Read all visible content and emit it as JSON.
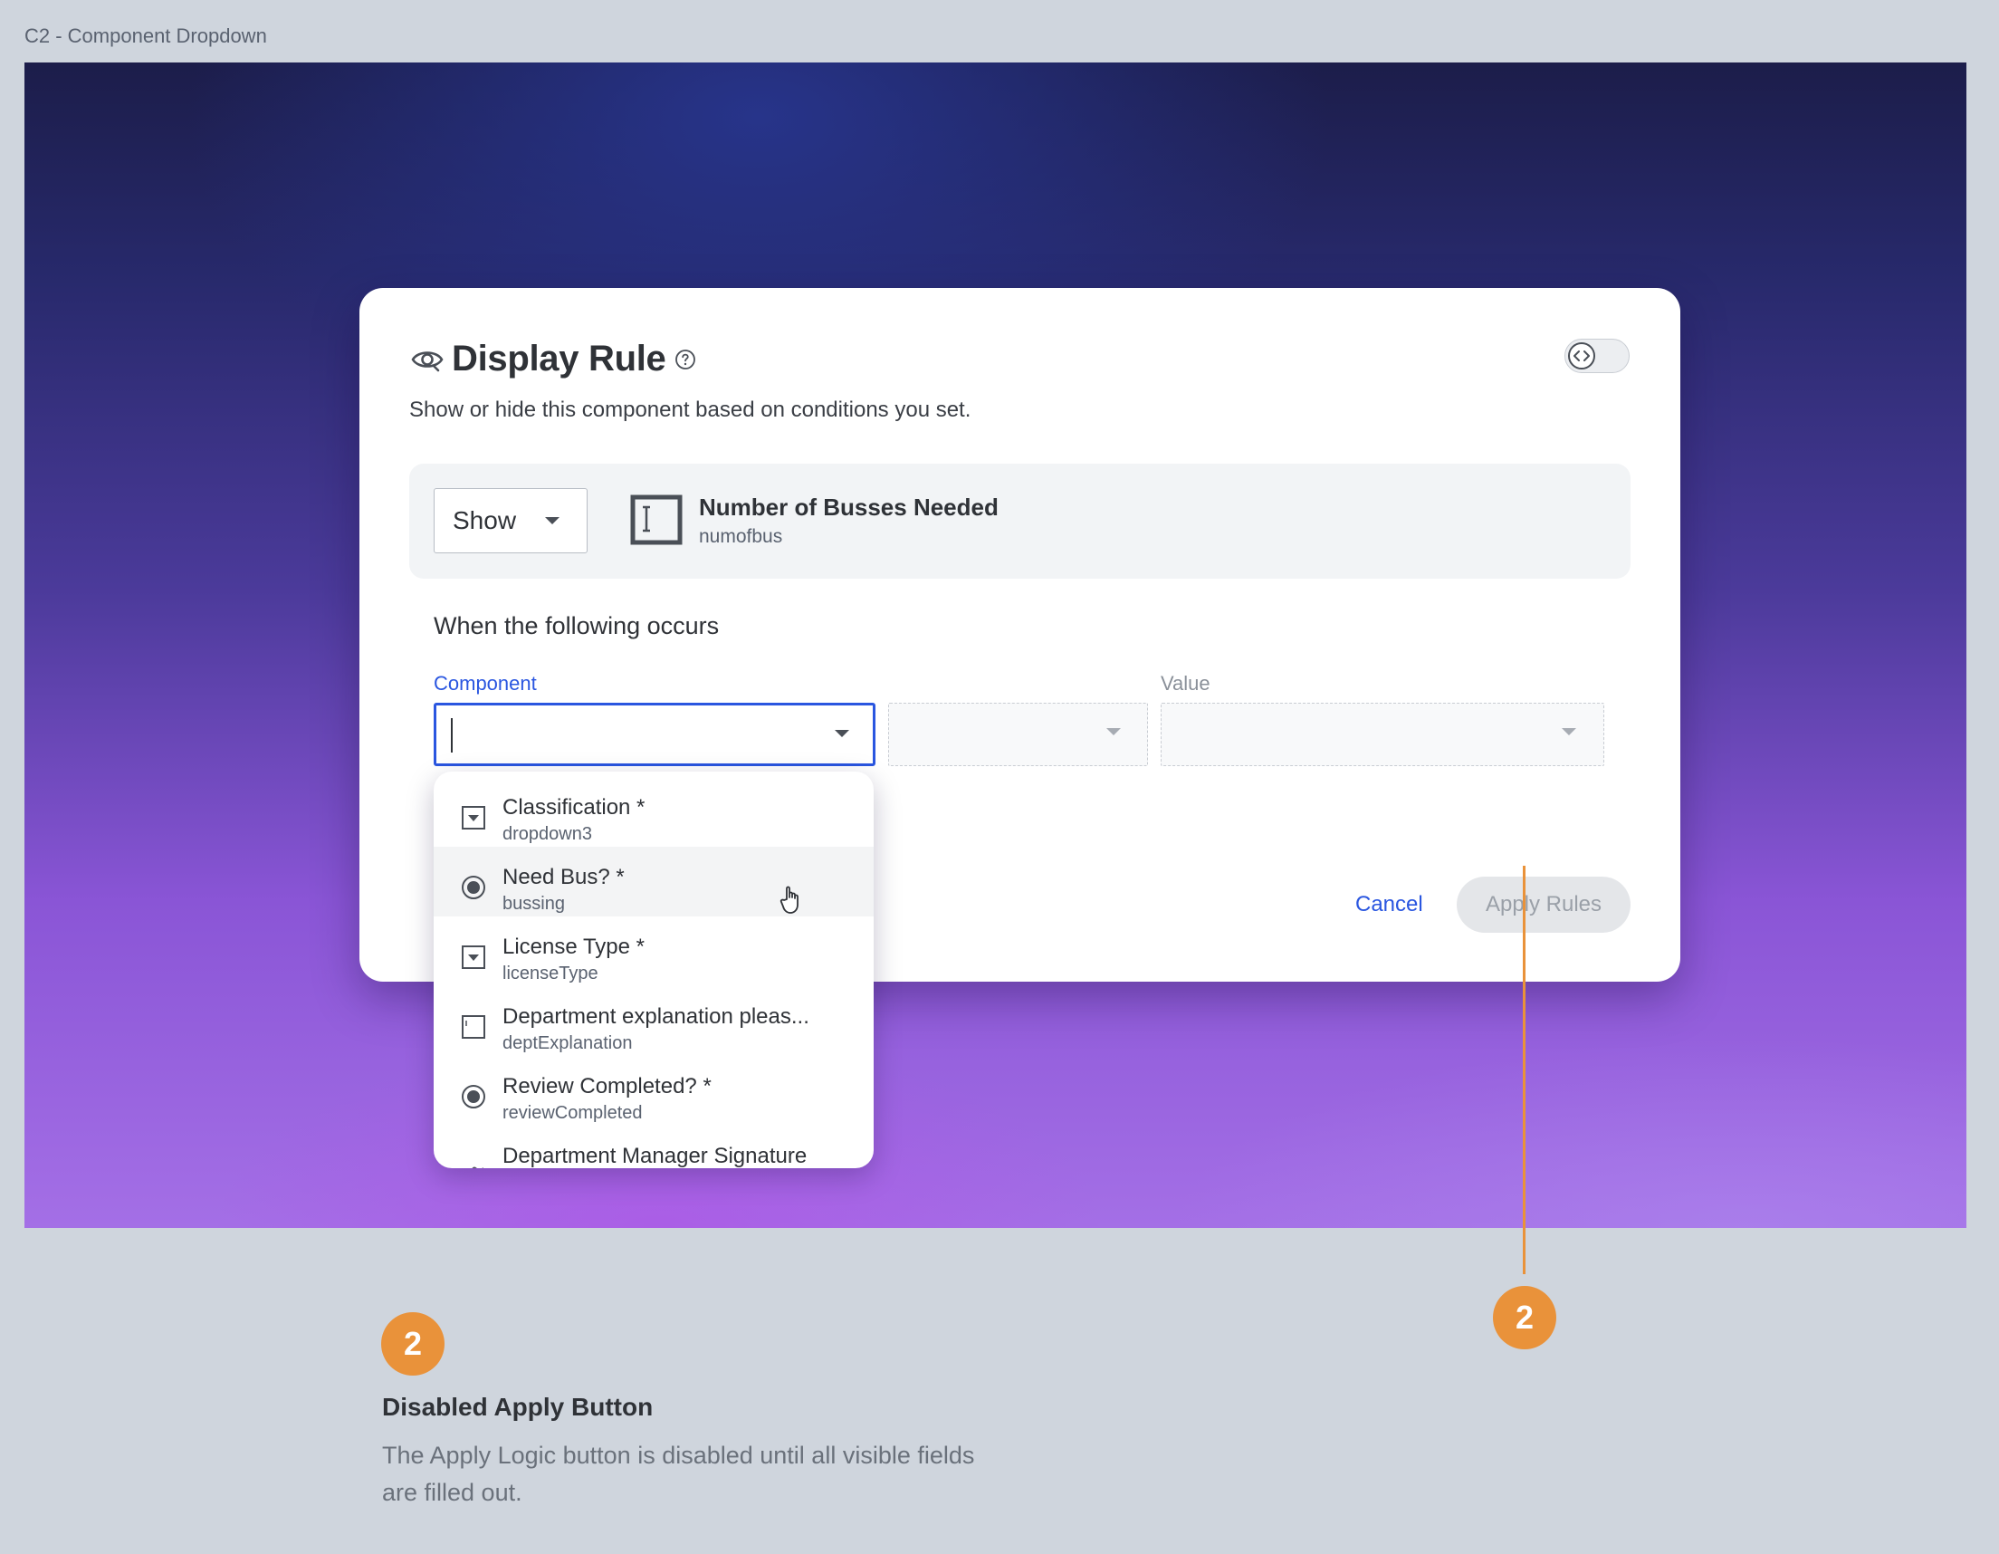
{
  "frame_label": "C2 - Component Dropdown",
  "modal": {
    "title": "Display Rule",
    "subtitle": "Show or hide this component based on conditions you set.",
    "target": {
      "action_value": "Show",
      "field_name": "Number of Busses Needed",
      "field_key": "numofbus"
    },
    "section_heading": "When the following occurs",
    "labels": {
      "component": "Component",
      "value": "Value"
    },
    "buttons": {
      "cancel": "Cancel",
      "apply": "Apply Rules"
    }
  },
  "dropdown": {
    "options": [
      {
        "name": "Classification *",
        "key": "dropdown3",
        "icon": "dropdown-icon"
      },
      {
        "name": "Need Bus? *",
        "key": "bussing",
        "icon": "radio-icon"
      },
      {
        "name": "License Type *",
        "key": "licenseType",
        "icon": "dropdown-icon"
      },
      {
        "name": "Department explanation pleas...",
        "key": "deptExplanation",
        "icon": "textarea-icon"
      },
      {
        "name": "Review Completed? *",
        "key": "reviewCompleted",
        "icon": "radio-icon"
      },
      {
        "name": "Department Manager Signature",
        "key": "",
        "icon": "signature-icon"
      }
    ]
  },
  "annotation": {
    "number": "2",
    "title": "Disabled Apply Button",
    "description": "The Apply Logic button is disabled until all visible fields are filled out."
  },
  "colors": {
    "accent": "#2a56e0",
    "callout": "#e9923a",
    "disabled_bg": "#e4e6e9"
  }
}
